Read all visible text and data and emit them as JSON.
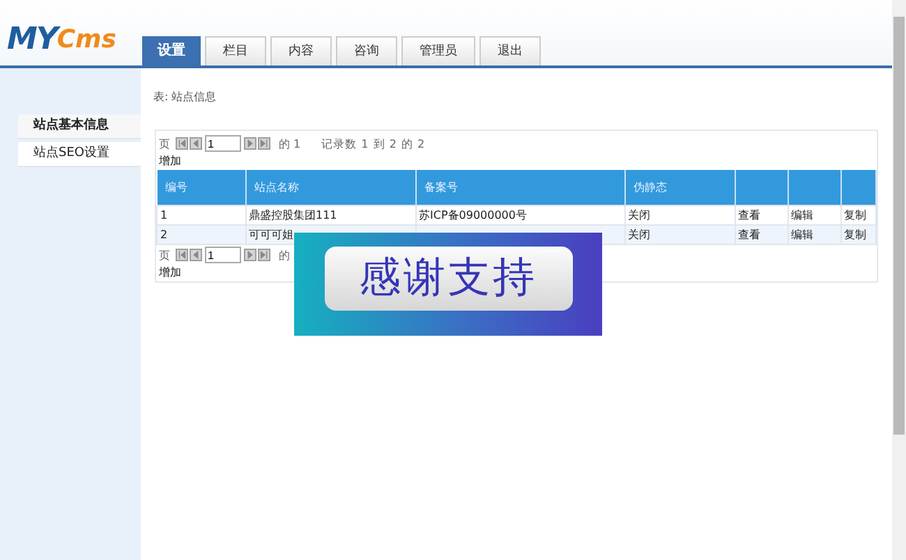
{
  "logo": {
    "main": "MY",
    "accent": "Cms"
  },
  "tabs": [
    {
      "label": "设置",
      "selected": true
    },
    {
      "label": "栏目",
      "selected": false
    },
    {
      "label": "内容",
      "selected": false
    },
    {
      "label": "咨询",
      "selected": false
    },
    {
      "label": "管理员",
      "selected": false
    },
    {
      "label": "退出",
      "selected": false
    }
  ],
  "sidebar": {
    "items": [
      {
        "label": "站点基本信息",
        "selected": true
      },
      {
        "label": "站点SEO设置",
        "selected": false
      }
    ]
  },
  "breadcrumb": "表: 站点信息",
  "pager_top": {
    "page_label": "页",
    "page": "1",
    "of_label": "的 1",
    "records": "记录数 1 到 2 的 2",
    "add": "增加"
  },
  "table": {
    "columns": [
      "编号",
      "站点名称",
      "备案号",
      "伪静态",
      "",
      "",
      ""
    ],
    "rows": [
      {
        "cells": [
          "1",
          "鼎盛控股集团111",
          "苏ICP备09000000号",
          "关闭",
          "查看",
          "编辑",
          "复制"
        ]
      },
      {
        "cells": [
          "2",
          "可可可姐",
          "",
          "关闭",
          "查看",
          "编辑",
          "复制"
        ]
      }
    ]
  },
  "pager_bottom": {
    "page_label": "页",
    "page": "1",
    "of_label": "的",
    "add": "增加"
  },
  "overlay": {
    "text": "感谢支持"
  }
}
